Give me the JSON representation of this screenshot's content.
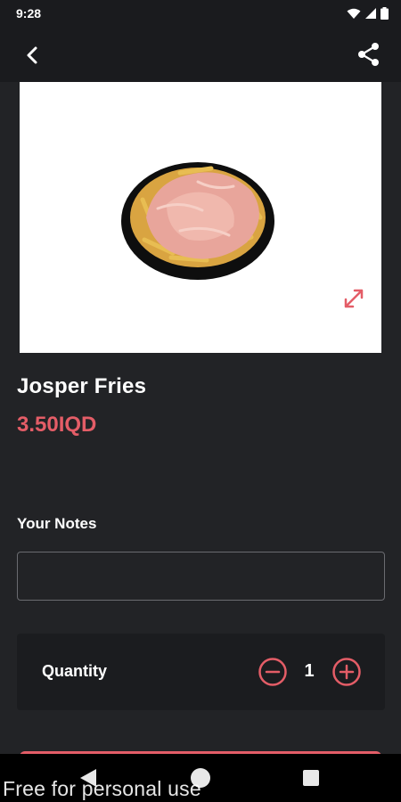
{
  "status_bar": {
    "time": "9:28"
  },
  "product": {
    "name": "Josper Fries",
    "price": "3.50IQD",
    "image_subject": "plate of fries with sauce"
  },
  "notes": {
    "label": "Your Notes",
    "value": ""
  },
  "quantity": {
    "label": "Quantity",
    "value": "1"
  },
  "watermark": "Free for personal use",
  "colors": {
    "accent": "#e45d67",
    "background": "#222326",
    "bar": "#1a1b1e",
    "card": "#1b1c1f"
  },
  "icons": [
    "back-arrow-icon",
    "share-icon",
    "expand-icon",
    "minus-circle-icon",
    "plus-circle-icon",
    "wifi-icon",
    "signal-icon",
    "battery-icon"
  ]
}
